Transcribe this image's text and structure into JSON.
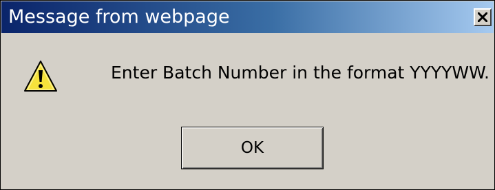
{
  "window": {
    "title": "Message from webpage",
    "close_glyph": "close-icon"
  },
  "dialog": {
    "icon": "warning-icon",
    "message": "Enter Batch Number in the format YYYYWW.",
    "ok_label": "OK"
  },
  "colors": {
    "titlebar_start": "#0a246a",
    "titlebar_end": "#a6caf0",
    "dialog_face": "#d4d0c8",
    "warning_yellow": "#f6e23c"
  }
}
